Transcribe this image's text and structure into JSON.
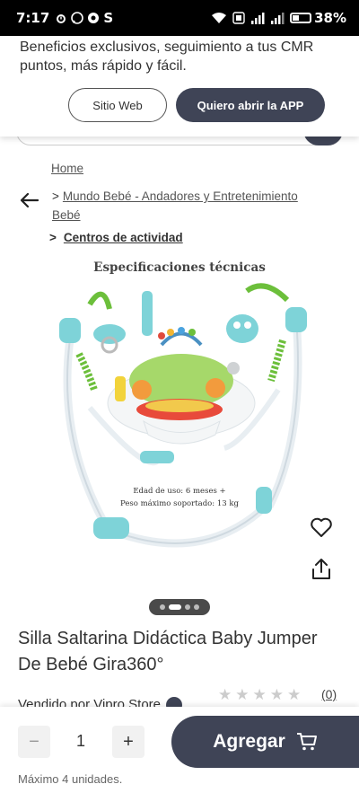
{
  "status_bar": {
    "time": "7:17",
    "left_icons": [
      "alarm-icon",
      "whatsapp-icon",
      "chrome-icon",
      "s-app-icon"
    ],
    "s_label": "S",
    "battery_percent": "38%",
    "battery_level": 0.38
  },
  "app_banner": {
    "text": "Beneficios exclusivos, seguimiento a tus CMR puntos, más rápido y fácil.",
    "web_button": "Sitio Web",
    "app_button": "Quiero abrir la APP"
  },
  "breadcrumb": {
    "sep": ">",
    "home": "Home",
    "mundo": "Mundo Bebé - Andadores y Entretenimiento Bebé",
    "centros": "Centros de actividad"
  },
  "product": {
    "image": {
      "spec_title": "Especificaciones técnicas",
      "age": "Edad de uso: 6 meses +",
      "weight": "Peso máximo soportado: 13 kg"
    },
    "carousel_dots": 4,
    "carousel_active": 1,
    "title": "Silla Saltarina Didáctica Baby Jumper De Bebé Gira360°",
    "seller_label": "Vendido por  Vipro Store",
    "rating": 0,
    "review_count": "(0)"
  },
  "purchase": {
    "minus": "−",
    "quantity": "1",
    "plus": "+",
    "add_label": "Agregar",
    "max_units": "Máximo 4 unidades."
  },
  "colors": {
    "primary": "#3f4456",
    "jumper_blue": "#7ed3d8",
    "jumper_green": "#6cbf3b"
  }
}
